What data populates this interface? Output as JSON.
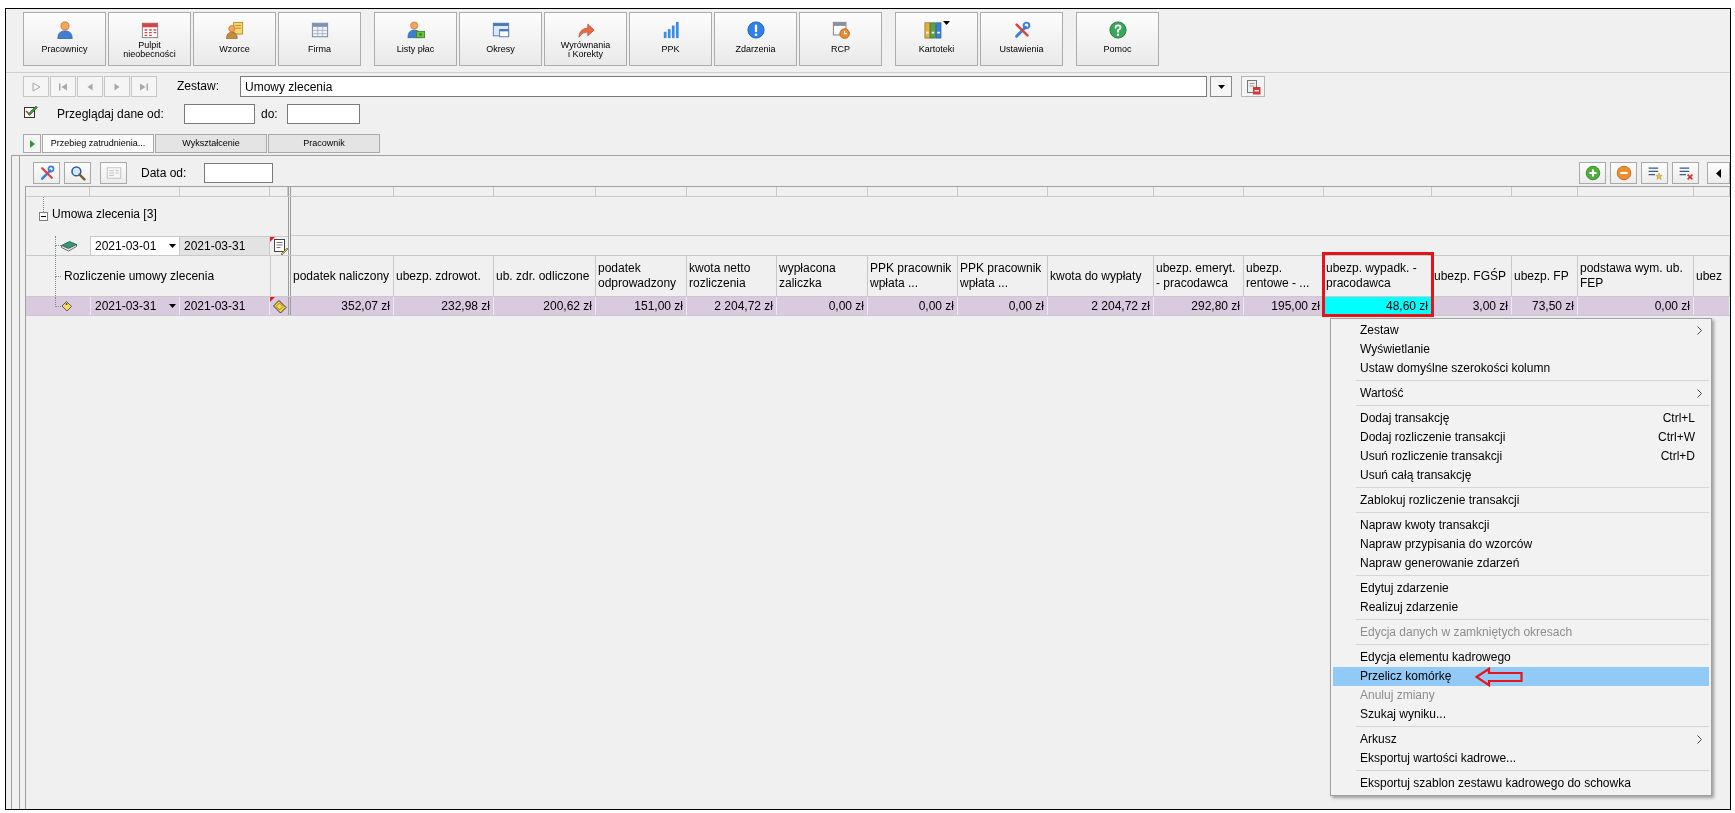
{
  "toolbar": {
    "groups": [
      {
        "buttons": [
          {
            "label": "Pracownicy",
            "dropdown": false
          },
          {
            "label": "Pulpit\nnieobecności",
            "dropdown": false
          },
          {
            "label": "Wzorce",
            "dropdown": false
          },
          {
            "label": "Firma",
            "dropdown": false
          }
        ]
      },
      {
        "buttons": [
          {
            "label": "Listy płac",
            "dropdown": false
          },
          {
            "label": "Okresy",
            "dropdown": false
          },
          {
            "label": "Wyrównania\ni Korekty",
            "dropdown": false
          },
          {
            "label": "PPK",
            "dropdown": false
          },
          {
            "label": "Zdarzenia",
            "dropdown": false
          },
          {
            "label": "RCP",
            "dropdown": false
          }
        ]
      },
      {
        "buttons": [
          {
            "label": "Kartoteki",
            "dropdown": true
          },
          {
            "label": "Ustawienia",
            "dropdown": false
          }
        ]
      },
      {
        "buttons": [
          {
            "label": "Pomoc",
            "dropdown": false
          }
        ]
      }
    ]
  },
  "record_navigator": [
    {
      "disabled": true
    },
    {
      "disabled": true
    },
    {
      "disabled": true
    },
    {
      "disabled": true
    },
    {
      "disabled": true
    }
  ],
  "set_selector": {
    "label": "Zestaw:",
    "value": "Umowy zlecenia"
  },
  "date_filter": {
    "label": "Przeglądaj dane od:",
    "to_label": "do:"
  },
  "tabs": [
    {
      "label": "Przebieg zatrudnienia...",
      "selected": true
    },
    {
      "label": "Wykształcenie",
      "selected": false
    },
    {
      "label": "Pracownik",
      "selected": false
    }
  ],
  "panel_toolbar": {
    "buttons": [
      {
        "disabled": false
      },
      {
        "disabled": false
      },
      {
        "disabled": true
      }
    ],
    "date_label": "Data od:"
  },
  "grid": {
    "group": {
      "label": "Umowa zlecenia [3]",
      "expanded": true
    },
    "transaction": {
      "from": "2021-03-01",
      "to": "2021-03-31"
    },
    "settlement_label": "Rozliczenie umowy zlecenia",
    "columns": [
      "podatek naliczony",
      "ubezp. zdrowot.",
      "ub. zdr. odliczone",
      "podatek odprowadzony",
      "kwota netto rozliczenia",
      "wypłacona zaliczka",
      "PPK pracownik wpłata ...",
      "PPK pracownik wpłata ...",
      "kwota do wypłaty",
      "ubezp. emeryt. - pracodawca",
      "ubezp. rentowe - ...",
      "ubezp. wypadk. - pracodawca",
      "ubezp. FGŚP",
      "ubezp. FP",
      "podstawa wym. ub. FEP",
      "ubez"
    ],
    "rows": [
      {
        "from": "2021-03-31",
        "to": "2021-03-31",
        "cells": [
          {
            "value": "352,07 zł",
            "selected": false
          },
          {
            "value": "232,98 zł",
            "selected": false
          },
          {
            "value": "200,62 zł",
            "selected": false
          },
          {
            "value": "151,00 zł",
            "selected": false
          },
          {
            "value": "2 204,72 zł",
            "selected": false
          },
          {
            "value": "0,00 zł",
            "selected": false
          },
          {
            "value": "0,00 zł",
            "selected": false
          },
          {
            "value": "0,00 zł",
            "selected": false
          },
          {
            "value": "2 204,72 zł",
            "selected": false
          },
          {
            "value": "292,80 zł",
            "selected": false
          },
          {
            "value": "195,00 zł",
            "selected": false
          },
          {
            "value": "48,60 zł",
            "selected": true
          },
          {
            "value": "3,00 zł",
            "selected": false
          },
          {
            "value": "73,50 zł",
            "selected": false
          },
          {
            "value": "0,00 zł",
            "selected": false
          }
        ]
      }
    ]
  },
  "context_menu": {
    "sections": [
      {
        "items": [
          {
            "label": "Zestaw",
            "submenu": true,
            "disabled": false,
            "selected": false
          },
          {
            "label": "Wyświetlanie",
            "submenu": false,
            "disabled": false,
            "selected": false
          },
          {
            "label": "Ustaw domyślne szerokości kolumn",
            "submenu": false,
            "disabled": false,
            "selected": false
          }
        ]
      },
      {
        "items": [
          {
            "label": "Wartość",
            "submenu": true,
            "disabled": false,
            "selected": false
          }
        ]
      },
      {
        "items": [
          {
            "label": "Dodaj transakcję",
            "shortcut": "Ctrl+L",
            "submenu": false,
            "disabled": false,
            "selected": false
          },
          {
            "label": "Dodaj rozliczenie transakcji",
            "shortcut": "Ctrl+W",
            "submenu": false,
            "disabled": false,
            "selected": false
          },
          {
            "label": "Usuń rozliczenie transakcji",
            "shortcut": "Ctrl+D",
            "submenu": false,
            "disabled": false,
            "selected": false
          },
          {
            "label": "Usuń całą transakcję",
            "submenu": false,
            "disabled": false,
            "selected": false
          }
        ]
      },
      {
        "items": [
          {
            "label": "Zablokuj rozliczenie transakcji",
            "submenu": false,
            "disabled": false,
            "selected": false
          }
        ]
      },
      {
        "items": [
          {
            "label": "Napraw kwoty transakcji",
            "submenu": false,
            "disabled": false,
            "selected": false
          },
          {
            "label": "Napraw przypisania do wzorców",
            "submenu": false,
            "disabled": false,
            "selected": false
          },
          {
            "label": "Napraw generowanie zdarzeń",
            "submenu": false,
            "disabled": false,
            "selected": false
          }
        ]
      },
      {
        "items": [
          {
            "label": "Edytuj zdarzenie",
            "submenu": false,
            "disabled": false,
            "selected": false
          },
          {
            "label": "Realizuj zdarzenie",
            "submenu": false,
            "disabled": false,
            "selected": false
          }
        ]
      },
      {
        "items": [
          {
            "label": "Edycja danych w zamkniętych okresach",
            "submenu": false,
            "disabled": true,
            "selected": false
          }
        ]
      },
      {
        "items": [
          {
            "label": "Edycja elementu kadrowego",
            "submenu": false,
            "disabled": false,
            "selected": false
          },
          {
            "label": "Przelicz komórkę",
            "submenu": false,
            "disabled": false,
            "selected": true
          },
          {
            "label": "Anuluj zmiany",
            "submenu": false,
            "disabled": true,
            "selected": false
          },
          {
            "label": "Szukaj wyniku...",
            "submenu": false,
            "disabled": false,
            "selected": false
          }
        ]
      },
      {
        "items": [
          {
            "label": "Arkusz",
            "submenu": true,
            "disabled": false,
            "selected": false
          },
          {
            "label": "Eksportuj wartości kadrowe...",
            "submenu": false,
            "disabled": false,
            "selected": false
          }
        ]
      },
      {
        "items": [
          {
            "label": "Eksportuj szablon zestawu kadrowego do schowka",
            "submenu": false,
            "disabled": false,
            "selected": false
          }
        ]
      }
    ]
  }
}
